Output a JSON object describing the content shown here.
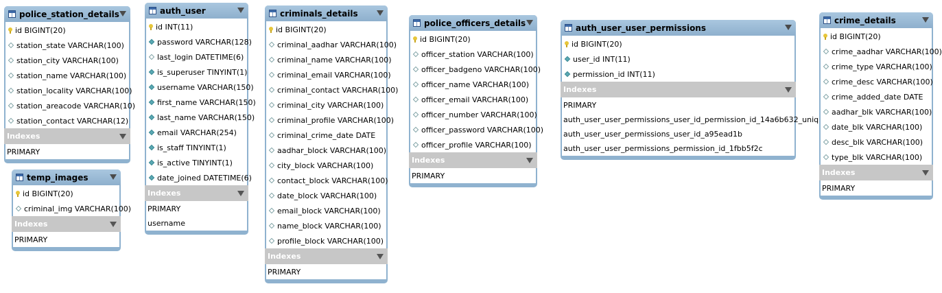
{
  "indexes_label": "Indexes",
  "tables": {
    "police_station_details": {
      "name": "police_station_details",
      "columns": [
        "id BIGINT(20)",
        "station_state VARCHAR(100)",
        "station_city VARCHAR(100)",
        "station_name VARCHAR(100)",
        "station_locality VARCHAR(100)",
        "station_areacode VARCHAR(10)",
        "station_contact VARCHAR(12)"
      ],
      "indexes": [
        "PRIMARY"
      ]
    },
    "temp_images": {
      "name": "temp_images",
      "columns": [
        "id BIGINT(20)",
        "criminal_img VARCHAR(100)"
      ],
      "indexes": [
        "PRIMARY"
      ]
    },
    "auth_user": {
      "name": "auth_user",
      "columns": [
        "id INT(11)",
        "password VARCHAR(128)",
        "last_login DATETIME(6)",
        "is_superuser TINYINT(1)",
        "username VARCHAR(150)",
        "first_name VARCHAR(150)",
        "last_name VARCHAR(150)",
        "email VARCHAR(254)",
        "is_staff TINYINT(1)",
        "is_active TINYINT(1)",
        "date_joined DATETIME(6)"
      ],
      "indexes": [
        "PRIMARY",
        "username"
      ]
    },
    "criminals_details": {
      "name": "criminals_details",
      "columns": [
        "id BIGINT(20)",
        "criminal_aadhar VARCHAR(100)",
        "criminal_name VARCHAR(100)",
        "criminal_email VARCHAR(100)",
        "criminal_contact VARCHAR(100)",
        "criminal_city VARCHAR(100)",
        "criminal_profile VARCHAR(100)",
        "criminal_crime_date DATE",
        "aadhar_block VARCHAR(100)",
        "city_block VARCHAR(100)",
        "contact_block VARCHAR(100)",
        "date_block VARCHAR(100)",
        "email_block VARCHAR(100)",
        "name_block VARCHAR(100)",
        "profile_block VARCHAR(100)"
      ],
      "indexes": [
        "PRIMARY"
      ]
    },
    "police_officers_details": {
      "name": "police_officers_details",
      "columns": [
        "id BIGINT(20)",
        "officer_station VARCHAR(100)",
        "officer_badgeno VARCHAR(100)",
        "officer_name VARCHAR(100)",
        "officer_email VARCHAR(100)",
        "officer_number VARCHAR(100)",
        "officer_password VARCHAR(100)",
        "officer_profile VARCHAR(100)"
      ],
      "indexes": [
        "PRIMARY"
      ]
    },
    "auth_user_user_permissions": {
      "name": "auth_user_user_permissions",
      "columns": [
        "id BIGINT(20)",
        "user_id INT(11)",
        "permission_id INT(11)"
      ],
      "indexes": [
        "PRIMARY",
        "auth_user_user_permissions_user_id_permission_id_14a6b632_uniq",
        "auth_user_user_permissions_user_id_a95ead1b",
        "auth_user_user_permissions_permission_id_1fbb5f2c"
      ]
    },
    "crime_details": {
      "name": "crime_details",
      "columns": [
        "id BIGINT(20)",
        "crime_aadhar VARCHAR(100)",
        "crime_type VARCHAR(100)",
        "crime_desc VARCHAR(100)",
        "crime_added_date DATE",
        "aadhar_blk VARCHAR(100)",
        "date_blk VARCHAR(100)",
        "desc_blk VARCHAR(100)",
        "type_blk VARCHAR(100)"
      ],
      "indexes": [
        "PRIMARY"
      ]
    }
  }
}
